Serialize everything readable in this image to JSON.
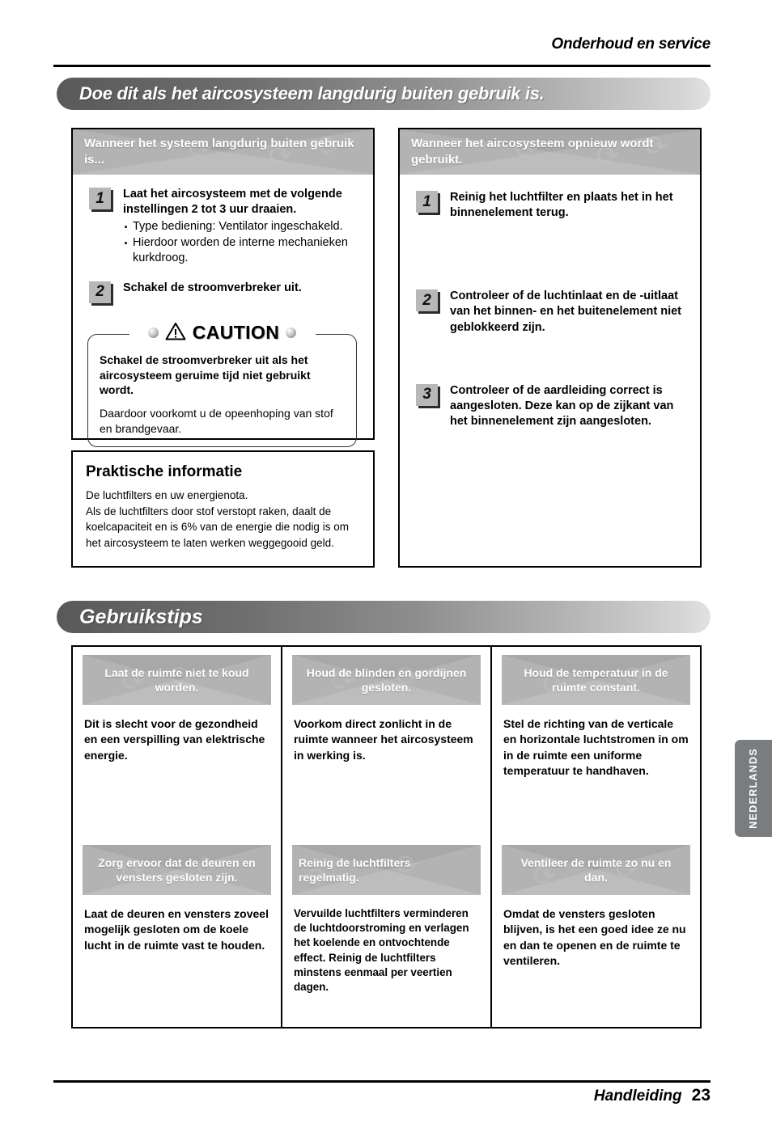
{
  "header": {
    "title": "Onderhoud en service"
  },
  "footer": {
    "label": "Handleiding",
    "page": "23"
  },
  "language_tab": {
    "label": "NEDERLANDS"
  },
  "sections": {
    "maintenance_bar": "Doe dit als het aircosysteem langdurig buiten gebruik is.",
    "tips_bar": "Gebruikstips"
  },
  "panel_left_top": {
    "head": "Wanneer het systeem langdurig buiten gebruik is...",
    "steps": [
      {
        "num": "1",
        "text": "Laat het aircosysteem met de volgende instellingen 2 tot 3 uur draaien.",
        "bullets": [
          "Type bediening: Ventilator ingeschakeld.",
          "Hierdoor worden de interne mechanieken",
          "kurkdroog."
        ]
      },
      {
        "num": "2",
        "text": "Schakel de stroomverbreker uit.",
        "bullets": []
      }
    ],
    "caution": {
      "title": "CAUTION",
      "icon": "warning-triangle-icon",
      "strong": "Schakel de stroomverbreker uit als het aircosysteem geruime tijd niet gebruikt wordt.",
      "note": "Daardoor voorkomt u de opeenhoping van stof en brandgevaar."
    }
  },
  "panel_left_bottom": {
    "title": "Praktische informatie",
    "lines": [
      "De luchtfilters en uw energienota.",
      "Als de luchtfilters door stof verstopt raken, daalt de",
      "koelcapaciteit en is 6% van de energie die nodig is om",
      "het aircosysteem te laten werken weggegooid geld."
    ]
  },
  "panel_right": {
    "head": "Wanneer het aircosysteem opnieuw wordt gebruikt.",
    "steps": [
      {
        "num": "1",
        "text": "Reinig het luchtfilter en plaats het in het binnenelement terug."
      },
      {
        "num": "2",
        "text": "Controleer of de luchtinlaat en de -uitlaat van het binnen- en het buitenelement niet geblokkeerd zijn."
      },
      {
        "num": "3",
        "text": "Controleer of de aardleiding correct is aangesloten. Deze kan op de zijkant van het binnenelement zijn aangesloten."
      }
    ]
  },
  "tips": {
    "columns": [
      {
        "cells": [
          {
            "head": "Laat de ruimte niet te koud worden.",
            "body": "Dit is slecht voor de gezondheid en een verspilling van elektrische energie."
          },
          {
            "head": "Zorg ervoor dat de deuren en vensters gesloten zijn.",
            "body": "Laat de deuren en vensters zoveel mogelijk gesloten om de koele lucht in de ruimte vast te houden."
          }
        ]
      },
      {
        "cells": [
          {
            "head": "Houd de blinden en gordijnen gesloten.",
            "body": "Voorkom direct zonlicht in de ruimte wanneer het aircosysteem in werking is."
          },
          {
            "head": "Reinig de luchtfilters regelmatig.",
            "body": "Vervuilde luchtfilters verminderen de luchtdoorstroming en verlagen het koelende en ontvochtende effect. Reinig de luchtfilters minstens eenmaal per veertien dagen."
          }
        ]
      },
      {
        "cells": [
          {
            "head": "Houd de temperatuur in de ruimte constant.",
            "body": "Stel de richting van de verticale en horizontale luchtstromen in om in de ruimte een uniforme temperatuur te handhaven."
          },
          {
            "head": "Ventileer de ruimte zo nu en dan.",
            "body": "Omdat de vensters gesloten blijven, is het een goed idee ze nu en dan te openen en de ruimte te ventileren."
          }
        ]
      }
    ]
  },
  "colors": {
    "bar_dark": "#595959",
    "bar_light": "#e2e2e2",
    "panel_head": "#a8a8a8",
    "tab": "#7a7d80",
    "rule": "#000000"
  }
}
